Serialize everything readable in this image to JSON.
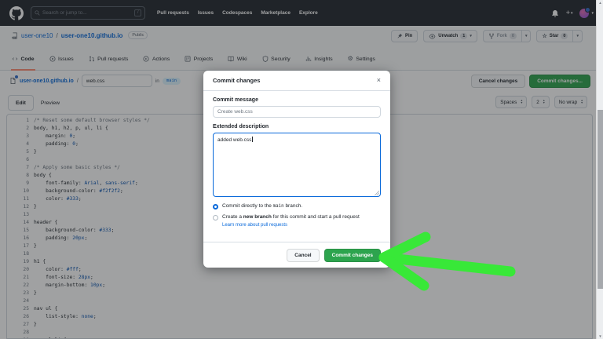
{
  "header": {
    "search": {
      "placeholder": "Search or jump to...",
      "shortcut": "/"
    },
    "nav": [
      "Pull requests",
      "Issues",
      "Codespaces",
      "Marketplace",
      "Explore"
    ]
  },
  "repo": {
    "owner": "user-one10",
    "separator": "/",
    "name": "user-one10.github.io",
    "visibility": "Public",
    "pin_label": "Pin",
    "unwatch_label": "Unwatch",
    "unwatch_count": "1",
    "fork_label": "Fork",
    "fork_count": "0",
    "star_label": "Star",
    "star_count": "0"
  },
  "repo_tabs": [
    {
      "label": "Code",
      "icon": "code-icon",
      "active": true
    },
    {
      "label": "Issues",
      "icon": "issue-icon",
      "active": false
    },
    {
      "label": "Pull requests",
      "icon": "pull-request-icon",
      "active": false
    },
    {
      "label": "Actions",
      "icon": "play-icon",
      "active": false
    },
    {
      "label": "Projects",
      "icon": "project-icon",
      "active": false
    },
    {
      "label": "Wiki",
      "icon": "book-icon",
      "active": false
    },
    {
      "label": "Security",
      "icon": "shield-icon",
      "active": false
    },
    {
      "label": "Insights",
      "icon": "graph-icon",
      "active": false
    },
    {
      "label": "Settings",
      "icon": "gear-icon",
      "active": false
    }
  ],
  "file_bar": {
    "repo_link": "user-one10.github.io",
    "separator": "/",
    "filename": "web.css",
    "in_label": "in",
    "branch": "main",
    "cancel_label": "Cancel changes",
    "commit_label": "Commit changes..."
  },
  "editor": {
    "mode_tabs": [
      {
        "label": "Edit",
        "active": true
      },
      {
        "label": "Preview",
        "active": false
      }
    ],
    "settings": [
      "Spaces",
      "2",
      "No wrap"
    ],
    "lines": [
      {
        "n": 1,
        "seg": [
          {
            "c": "comment",
            "t": "/* Reset some default browser styles */"
          }
        ]
      },
      {
        "n": 2,
        "seg": [
          {
            "c": "plain",
            "t": "body, h1, h2, p, ul, li {"
          }
        ]
      },
      {
        "n": 3,
        "seg": [
          {
            "c": "plain",
            "t": "    margin: "
          },
          {
            "c": "value",
            "t": "0"
          },
          {
            "c": "plain",
            "t": ";"
          }
        ]
      },
      {
        "n": 4,
        "seg": [
          {
            "c": "plain",
            "t": "    padding: "
          },
          {
            "c": "value",
            "t": "0"
          },
          {
            "c": "plain",
            "t": ";"
          }
        ]
      },
      {
        "n": 5,
        "seg": [
          {
            "c": "plain",
            "t": "}"
          }
        ]
      },
      {
        "n": 6,
        "seg": []
      },
      {
        "n": 7,
        "seg": [
          {
            "c": "comment",
            "t": "/* Apply some basic styles */"
          }
        ]
      },
      {
        "n": 8,
        "seg": [
          {
            "c": "plain",
            "t": "body {"
          }
        ]
      },
      {
        "n": 9,
        "seg": [
          {
            "c": "plain",
            "t": "    font-family: "
          },
          {
            "c": "value",
            "t": "Arial"
          },
          {
            "c": "plain",
            "t": ", "
          },
          {
            "c": "value",
            "t": "sans-serif"
          },
          {
            "c": "plain",
            "t": ";"
          }
        ]
      },
      {
        "n": 10,
        "seg": [
          {
            "c": "plain",
            "t": "    background-color: "
          },
          {
            "c": "value",
            "t": "#f2f2f2"
          },
          {
            "c": "plain",
            "t": ";"
          }
        ]
      },
      {
        "n": 11,
        "seg": [
          {
            "c": "plain",
            "t": "    color: "
          },
          {
            "c": "value",
            "t": "#333"
          },
          {
            "c": "plain",
            "t": ";"
          }
        ]
      },
      {
        "n": 12,
        "seg": [
          {
            "c": "plain",
            "t": "}"
          }
        ]
      },
      {
        "n": 13,
        "seg": []
      },
      {
        "n": 14,
        "seg": [
          {
            "c": "plain",
            "t": "header {"
          }
        ]
      },
      {
        "n": 15,
        "seg": [
          {
            "c": "plain",
            "t": "    background-color: "
          },
          {
            "c": "value",
            "t": "#333"
          },
          {
            "c": "plain",
            "t": ";"
          }
        ]
      },
      {
        "n": 16,
        "seg": [
          {
            "c": "plain",
            "t": "    padding: "
          },
          {
            "c": "value",
            "t": "20px"
          },
          {
            "c": "plain",
            "t": ";"
          }
        ]
      },
      {
        "n": 17,
        "seg": [
          {
            "c": "plain",
            "t": "}"
          }
        ]
      },
      {
        "n": 18,
        "seg": []
      },
      {
        "n": 19,
        "seg": [
          {
            "c": "plain",
            "t": "h1 {"
          }
        ]
      },
      {
        "n": 20,
        "seg": [
          {
            "c": "plain",
            "t": "    color: "
          },
          {
            "c": "value",
            "t": "#fff"
          },
          {
            "c": "plain",
            "t": ";"
          }
        ]
      },
      {
        "n": 21,
        "seg": [
          {
            "c": "plain",
            "t": "    font-size: "
          },
          {
            "c": "value",
            "t": "28px"
          },
          {
            "c": "plain",
            "t": ";"
          }
        ]
      },
      {
        "n": 22,
        "seg": [
          {
            "c": "plain",
            "t": "    margin-bottom: "
          },
          {
            "c": "value",
            "t": "10px"
          },
          {
            "c": "plain",
            "t": ";"
          }
        ]
      },
      {
        "n": 23,
        "seg": [
          {
            "c": "plain",
            "t": "}"
          }
        ]
      },
      {
        "n": 24,
        "seg": []
      },
      {
        "n": 25,
        "seg": [
          {
            "c": "plain",
            "t": "nav ul {"
          }
        ]
      },
      {
        "n": 26,
        "seg": [
          {
            "c": "plain",
            "t": "    list-style: "
          },
          {
            "c": "value",
            "t": "none"
          },
          {
            "c": "plain",
            "t": ";"
          }
        ]
      },
      {
        "n": 27,
        "seg": [
          {
            "c": "plain",
            "t": "}"
          }
        ]
      },
      {
        "n": 28,
        "seg": []
      },
      {
        "n": 29,
        "seg": [
          {
            "c": "plain",
            "t": "nav ul li {"
          }
        ]
      }
    ]
  },
  "modal": {
    "title": "Commit changes",
    "close": "×",
    "commit_message_label": "Commit message",
    "commit_message_placeholder": "Create web.css",
    "extended_label": "Extended description",
    "extended_value": "added web.css",
    "radio1_pre": "Commit directly to the ",
    "radio1_branch": "main",
    "radio1_post": " branch.",
    "radio2_pre": "Create a ",
    "radio2_bold": "new branch",
    "radio2_post": " for this commit and start a pull request",
    "learn_more": "Learn more about pull requests",
    "cancel_label": "Cancel",
    "commit_label": "Commit changes"
  },
  "colors": {
    "header_bg": "#24292f",
    "accent_green": "#2da44e",
    "link_blue": "#0969da",
    "tab_underline": "#fd8c73",
    "branch_badge_bg": "#ddf4ff",
    "code_value": "#0550ae",
    "code_comment": "#6e7781",
    "annotation_arrow": "#38e838",
    "overlay": "rgba(28,30,34,0.42)"
  }
}
